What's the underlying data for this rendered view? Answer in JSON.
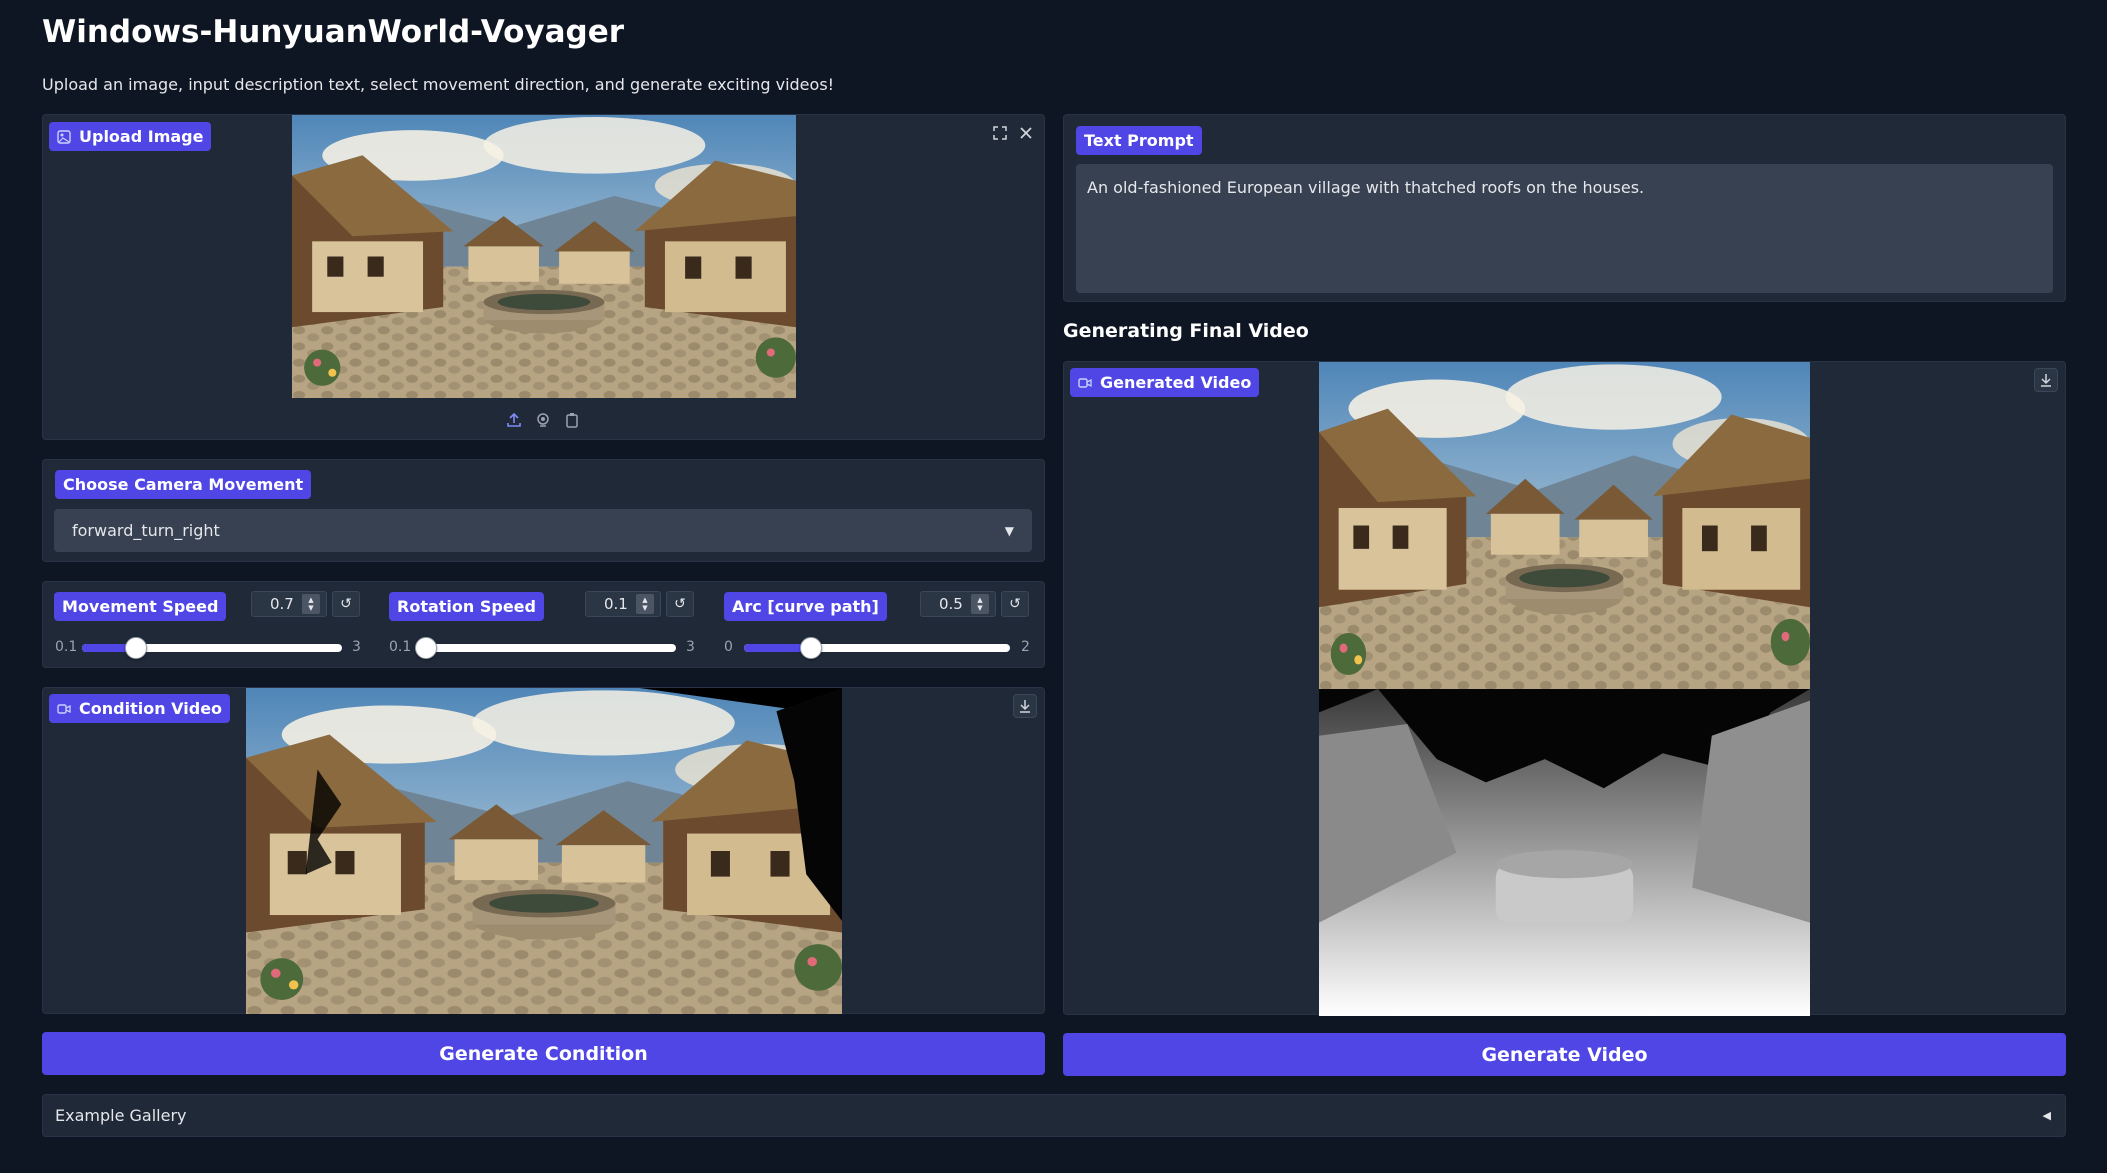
{
  "header": {
    "title": "Windows-HunyuanWorld-Voyager",
    "subtitle": "Upload an image, input description text, select movement direction, and generate exciting videos!"
  },
  "upload": {
    "label": "Upload Image",
    "icons": [
      "image-icon",
      "fullscreen-icon",
      "close-icon",
      "upload-icon",
      "webcam-icon",
      "clipboard-icon"
    ]
  },
  "camera": {
    "label": "Choose Camera Movement",
    "selected": "forward_turn_right"
  },
  "sliders": [
    {
      "label": "Movement Speed",
      "value": "0.7",
      "min": "0.1",
      "max": "3",
      "fraction": 0.207
    },
    {
      "label": "Rotation Speed",
      "value": "0.1",
      "min": "0.1",
      "max": "3",
      "fraction": 0.0
    },
    {
      "label": "Arc [curve path]",
      "value": "0.5",
      "min": "0",
      "max": "2",
      "fraction": 0.25
    }
  ],
  "condition": {
    "label": "Condition Video"
  },
  "prompt": {
    "label": "Text Prompt",
    "value": "An old-fashioned European village with thatched roofs on the houses."
  },
  "final": {
    "heading": "Generating Final Video",
    "label": "Generated Video"
  },
  "buttons": {
    "generate_condition": "Generate Condition",
    "generate_video": "Generate Video"
  },
  "gallery": {
    "label": "Example Gallery"
  },
  "colors": {
    "accent": "#4f46e5",
    "background": "#0f1623",
    "panel": "#1f2937"
  }
}
